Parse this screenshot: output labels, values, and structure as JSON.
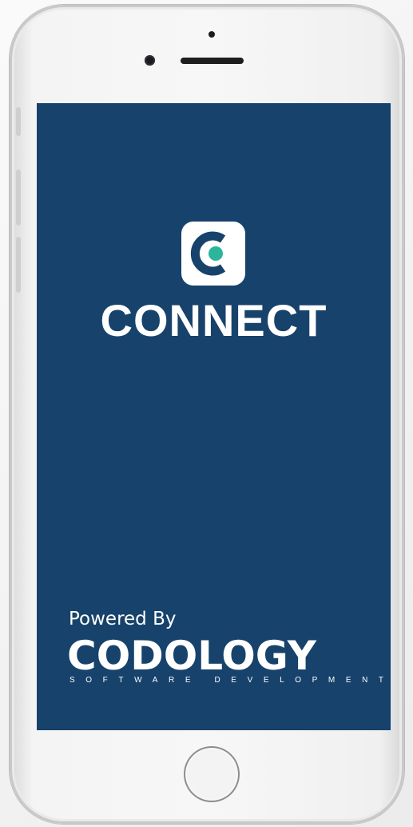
{
  "app": {
    "name": "CONNECT",
    "logo_letter": "C"
  },
  "footer": {
    "powered_label": "Powered By",
    "brand_name": "CODOLOGY",
    "brand_tagline": "SOFTWARE DEVELOPMENT"
  },
  "colors": {
    "screen_background": "#17426b",
    "logo_accent": "#2bb59a",
    "text": "#ffffff"
  },
  "icons": {
    "app_logo": "connect-logo-icon",
    "home": "home-button-icon"
  }
}
